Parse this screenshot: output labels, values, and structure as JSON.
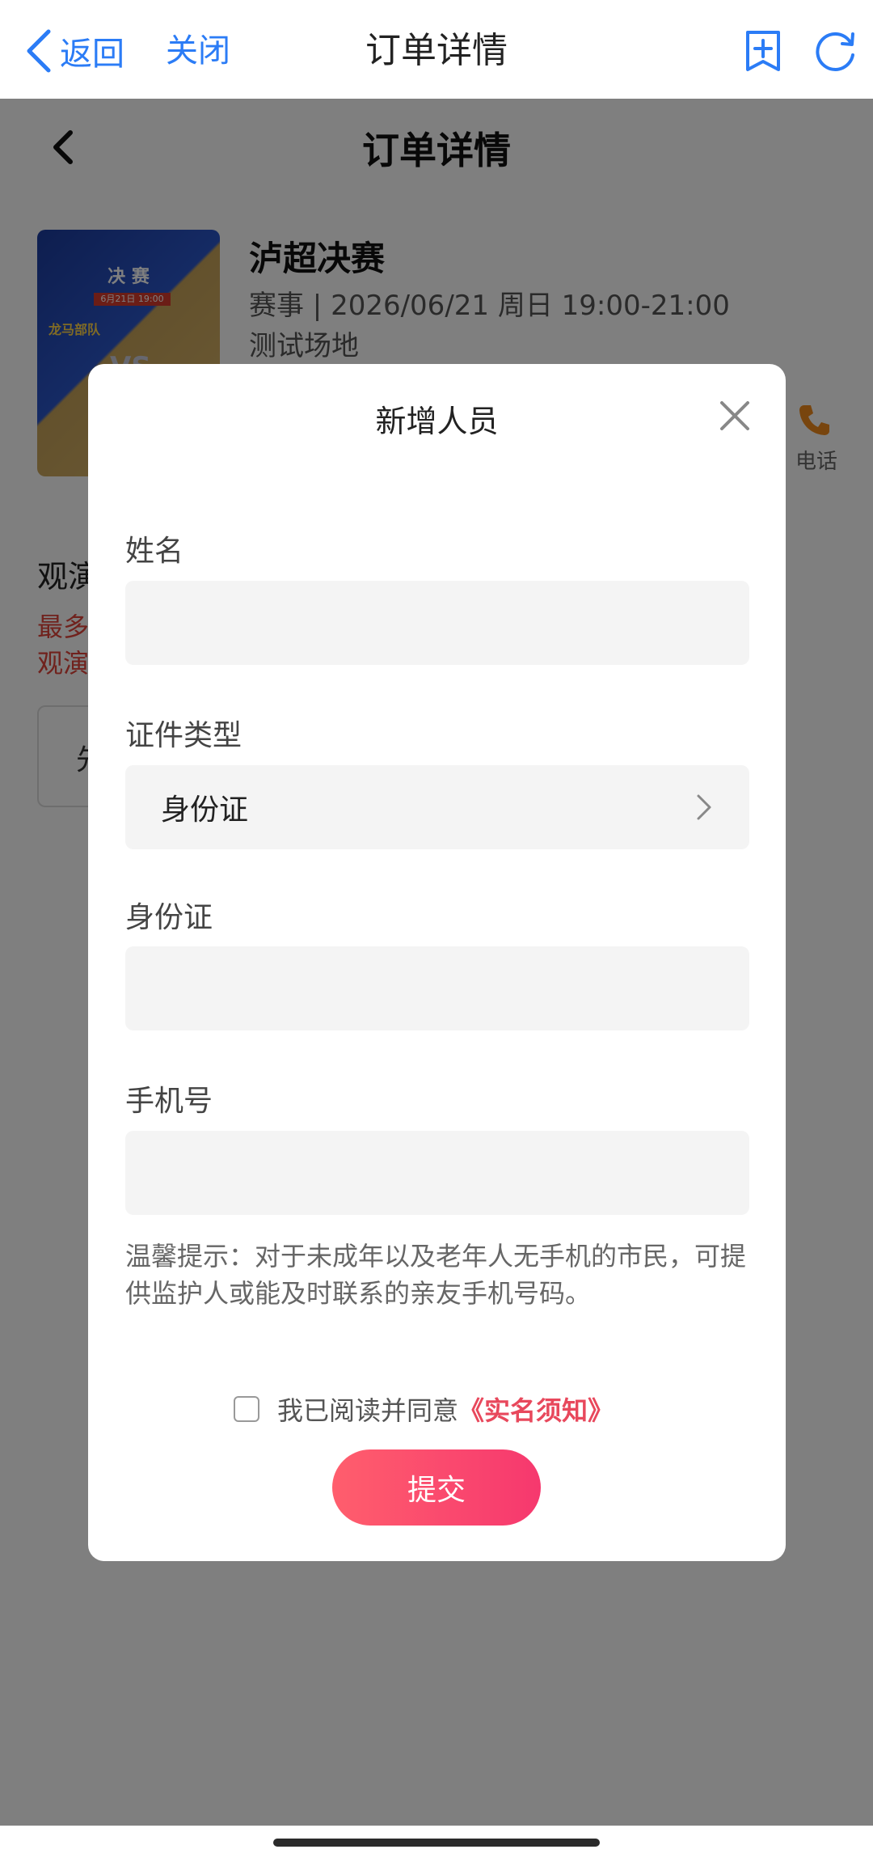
{
  "nav": {
    "back_label": "返回",
    "close_label": "关闭",
    "title": "订单详情"
  },
  "page": {
    "title": "订单详情",
    "event": {
      "poster_title": "决 赛",
      "poster_date": "6月21日 19:00",
      "poster_team": "龙马部队",
      "poster_vs": "VS",
      "name": "泸超决赛",
      "meta": "赛事 | 2026/06/21 周日 19:00-21:00",
      "venue": "测试场地"
    },
    "phone_label": "电话",
    "section_title_fragment": "观演",
    "red_line_1": "最多",
    "red_line_2": "观演",
    "box_fragment": "先"
  },
  "modal": {
    "title": "新增人员",
    "fields": {
      "name_label": "姓名",
      "name_value": "",
      "id_type_label": "证件类型",
      "id_type_value": "身份证",
      "id_number_label": "身份证",
      "id_number_value": "",
      "phone_label": "手机号",
      "phone_value": ""
    },
    "tip": "温馨提示：对于未成年以及老年人无手机的市民，可提供监护人或能及时联系的亲友手机号码。",
    "agree_text": "我已阅读并同意",
    "agree_link": "《实名须知》",
    "agree_checked": false,
    "submit_label": "提交"
  },
  "colors": {
    "link_blue": "#2b7cf6",
    "accent_red": "#e8485c",
    "submit_gradient_start": "#ff5e6d",
    "submit_gradient_end": "#f6386e"
  },
  "icons": {
    "nav_back": "chevron-left-icon",
    "nav_add": "add-bookmark-icon",
    "nav_refresh": "refresh-icon",
    "modal_close": "close-icon",
    "select_arrow": "chevron-right-icon",
    "phone": "phone-icon"
  }
}
